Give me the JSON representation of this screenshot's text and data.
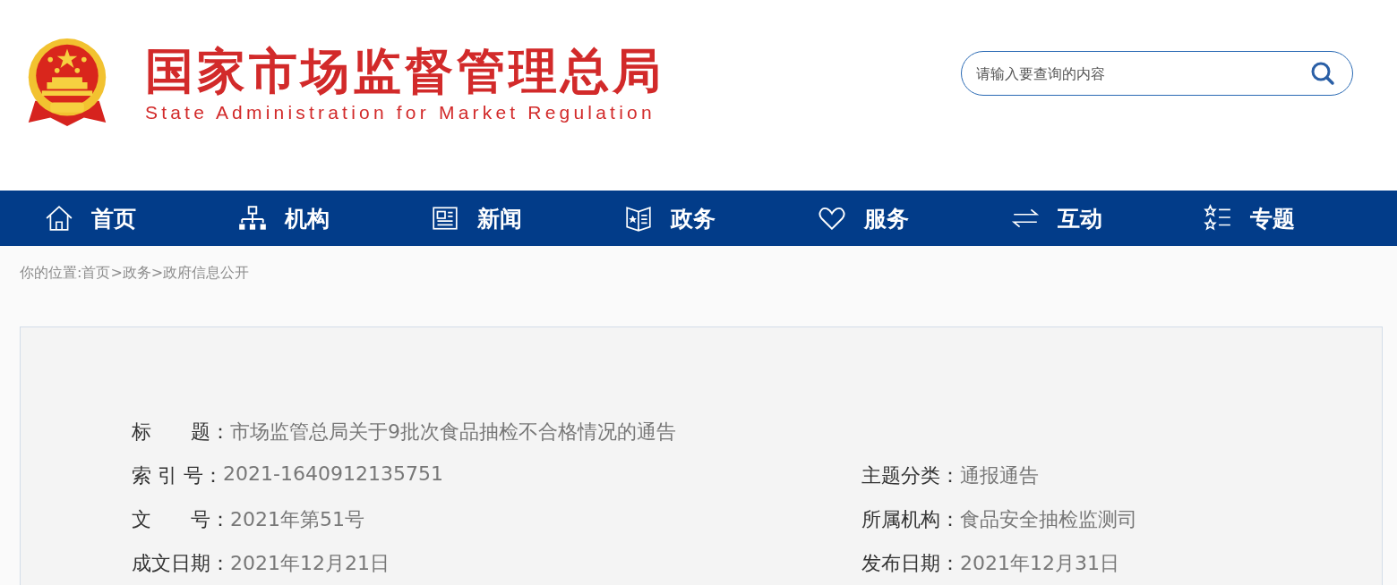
{
  "header": {
    "title_cn": "国家市场监督管理总局",
    "title_en": "State Administration for Market Regulation",
    "search": {
      "placeholder": "请输入要查询的内容"
    }
  },
  "nav": [
    {
      "label": "首页"
    },
    {
      "label": "机构"
    },
    {
      "label": "新闻"
    },
    {
      "label": "政务"
    },
    {
      "label": "服务"
    },
    {
      "label": "互动"
    },
    {
      "label": "专题"
    }
  ],
  "breadcrumb": "你的位置:首页>政务>政府信息公开",
  "info_rows": [
    [
      {
        "label": "标　　题：",
        "value": "市场监管总局关于9批次食品抽检不合格情况的通告"
      }
    ],
    [
      {
        "label": "索 引 号：",
        "value": "2021-1640912135751"
      },
      {
        "label": "主题分类：",
        "value": "通报通告"
      }
    ],
    [
      {
        "label": "文　　号：",
        "value": "2021年第51号"
      },
      {
        "label": "所属机构：",
        "value": "食品安全抽检监测司"
      }
    ],
    [
      {
        "label": "成文日期：",
        "value": "2021年12月21日"
      },
      {
        "label": "发布日期：",
        "value": "2021年12月31日"
      }
    ]
  ]
}
